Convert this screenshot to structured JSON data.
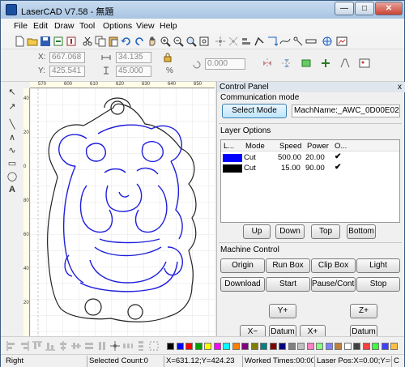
{
  "window": {
    "title": "LaserCAD V7.58 - 無題",
    "minimize": "—",
    "maximize": "□",
    "close": "✕"
  },
  "menu": [
    "File",
    "Edit",
    "Draw",
    "Tool",
    "Options",
    "View",
    "Help"
  ],
  "coords": {
    "x_label": "X:",
    "x_value": "667.068",
    "y_label": "Y:",
    "y_value": "425.541",
    "w_value": "34.135",
    "h_value": "45.000",
    "angle_value": "0.000",
    "percent": "%"
  },
  "ruler": {
    "h_ticks": [
      "570",
      "600",
      "610",
      "620",
      "630",
      "640",
      "650"
    ],
    "v_ticks": [
      "40",
      "20",
      "0",
      "80",
      "60",
      "40",
      "20"
    ]
  },
  "panel": {
    "title": "Control Panel",
    "close": "x",
    "communication_mode": "Communication mode",
    "select_mode": "Select Mode",
    "machine_name": "MachName:_AWC_0D00E022",
    "layer_options": "Layer Options",
    "layer_headers": [
      "L...",
      "Mode",
      "Speed",
      "Power",
      "O..."
    ],
    "layers": [
      {
        "color": "#0000ff",
        "mode": "Cut",
        "speed": "500.00",
        "power": "20.00",
        "output": "✔"
      },
      {
        "color": "#000000",
        "mode": "Cut",
        "speed": "15.00",
        "power": "90.00",
        "output": "✔"
      }
    ],
    "layer_buttons": [
      "Up",
      "Down",
      "Top",
      "Bottom"
    ],
    "machine_control": "Machine Control",
    "control_buttons": [
      "Origin",
      "Run Box",
      "Clip Box",
      "Light",
      "Download",
      "Start",
      "Pause/Continue",
      "Stop"
    ],
    "jog": {
      "y_plus": "Y+",
      "z_plus": "Z+",
      "x_minus": "X−",
      "datum": "Datum",
      "x_plus": "X+",
      "datum2": "Datum"
    }
  },
  "palette": [
    "#000000",
    "#0000ff",
    "#ff0000",
    "#00a000",
    "#ffff00",
    "#ff00ff",
    "#00ffff",
    "#ff8000",
    "#800080",
    "#808000",
    "#008080",
    "#800000",
    "#000080",
    "#808080",
    "#c0c0c0",
    "#ff80c0",
    "#80ff80",
    "#8080ff",
    "#c08040",
    "#ffffff",
    "#404040",
    "#ff4040",
    "#40ff40",
    "#4040ff",
    "#ffc040"
  ],
  "status": {
    "mode": "Right",
    "selected": "Selected Count:0",
    "cursor": "X=631.12;Y=424.23",
    "worked": "Worked Times:00:00",
    "laser": "Laser Pos:X=0.00;Y=0.00",
    "extra": "C"
  },
  "colors": {
    "layer_blue": "#0000ff",
    "layer_black": "#000000",
    "select_blue": "#bee6fd"
  }
}
